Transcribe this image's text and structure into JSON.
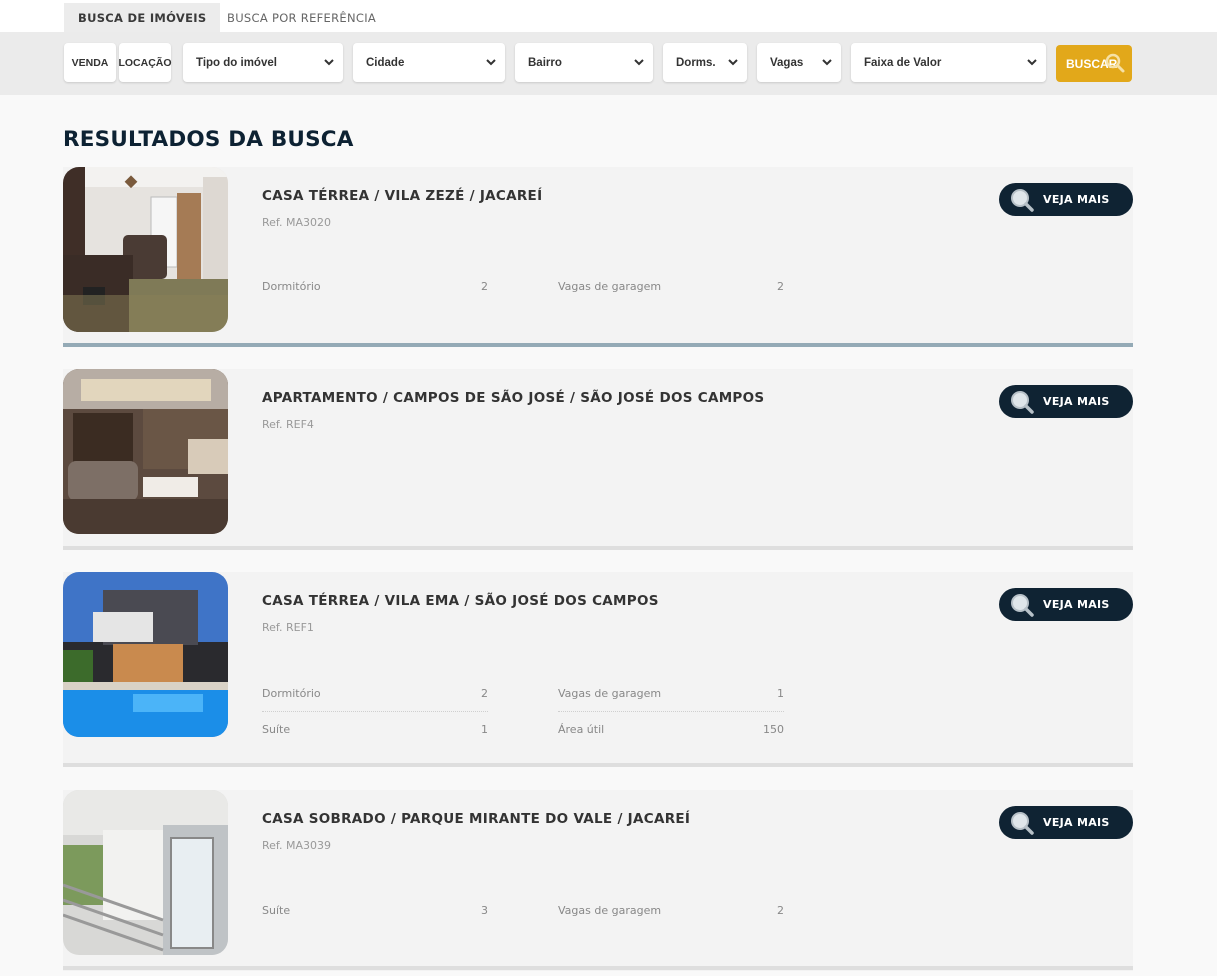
{
  "tabs": {
    "active": "BUSCA DE IMÓVEIS",
    "inactive": "BUSCA POR REFERÊNCIA"
  },
  "filters": {
    "venda": "VENDA",
    "locacao": "LOCAÇÃO",
    "tipo": "Tipo do imóvel",
    "cidade": "Cidade",
    "bairro": "Bairro",
    "dorms": "Dorms.",
    "vagas": "Vagas",
    "faixa": "Faixa de Valor",
    "buscar": "BUSCAR"
  },
  "page_title": "RESULTADOS DA BUSCA",
  "results": [
    {
      "title": "CASA TÉRREA / VILA ZEZÉ / JACAREÍ",
      "ref": "Ref. MA3020",
      "button": "VEJA MAIS",
      "features": [
        {
          "label": "Dormitório",
          "value": "2"
        },
        {
          "label": "Vagas de garagem",
          "value": "2"
        }
      ]
    },
    {
      "title": "APARTAMENTO / CAMPOS DE SÃO JOSÉ / SÃO JOSÉ DOS CAMPOS",
      "ref": "Ref. REF4",
      "button": "VEJA MAIS",
      "features": []
    },
    {
      "title": "CASA TÉRREA / VILA EMA / SÃO JOSÉ DOS CAMPOS",
      "ref": "Ref. REF1",
      "button": "VEJA MAIS",
      "features": [
        {
          "label": "Dormitório",
          "value": "2"
        },
        {
          "label": "Vagas de garagem",
          "value": "1"
        },
        {
          "label": "Suíte",
          "value": "1"
        },
        {
          "label": "Área útil",
          "value": "150"
        }
      ]
    },
    {
      "title": "CASA SOBRADO / PARQUE MIRANTE DO VALE / JACAREÍ",
      "ref": "Ref. MA3039",
      "button": "VEJA MAIS",
      "features": [
        {
          "label": "Suíte",
          "value": "3"
        },
        {
          "label": "Vagas de garagem",
          "value": "2"
        }
      ]
    }
  ],
  "colors": {
    "accent": "#e2a81a",
    "navy": "#0f2333",
    "title": "#0d2233"
  },
  "icons": {
    "search": "search-icon",
    "chevron": "chevron-down-icon"
  }
}
